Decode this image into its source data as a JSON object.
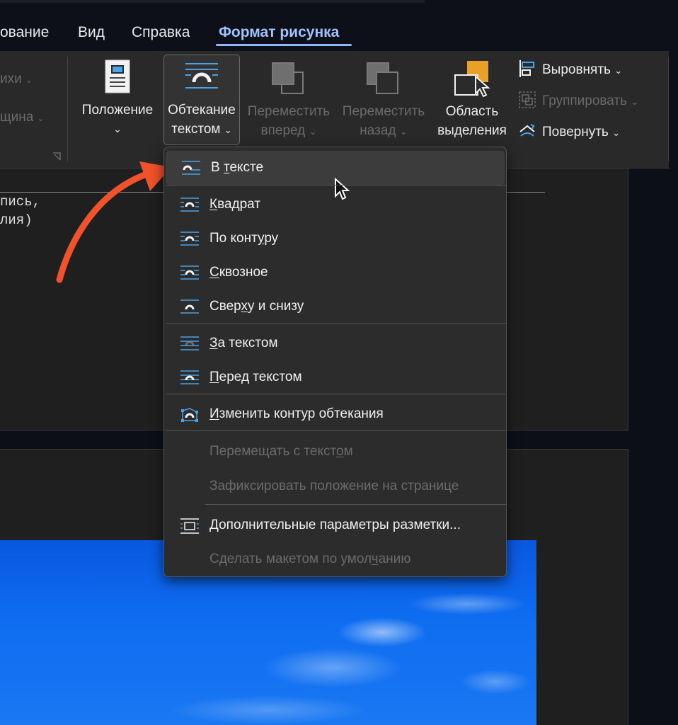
{
  "tabs": [
    {
      "label": "ование"
    },
    {
      "label": "Вид"
    },
    {
      "label": "Справка"
    },
    {
      "label": "Формат рисунка"
    }
  ],
  "ribbon": {
    "left_partial": {
      "item1": "ихи",
      "item2": "щина"
    },
    "position": {
      "line1": "Положение"
    },
    "wrap": {
      "line1": "Обтекание",
      "line2": "текстом"
    },
    "forward": {
      "line1": "Переместить",
      "line2": "вперед"
    },
    "backward": {
      "line1": "Переместить",
      "line2": "назад"
    },
    "selection": {
      "line1": "Область",
      "line2": "выделения"
    },
    "align": {
      "label": "Выровнять"
    },
    "group": {
      "label": "Группировать"
    },
    "rotate": {
      "label": "Повернуть"
    }
  },
  "document": {
    "line1": "пись,",
    "line2": "лия)"
  },
  "menu": {
    "items": [
      {
        "pre": "В ",
        "ul": "т",
        "post": "ексте",
        "icon": "wrap-inline-icon",
        "enabled": true
      },
      {
        "pre": "",
        "ul": "К",
        "post": "вадрат",
        "icon": "wrap-square-icon",
        "enabled": true
      },
      {
        "pre": "По конт",
        "ul": "у",
        "post": "ру",
        "icon": "wrap-tight-icon",
        "enabled": true
      },
      {
        "pre": "",
        "ul": "С",
        "post": "квозное",
        "icon": "wrap-through-icon",
        "enabled": true
      },
      {
        "pre": "Свер",
        "ul": "х",
        "post": "у и снизу",
        "icon": "wrap-top-bottom-icon",
        "enabled": true
      },
      {
        "pre": "",
        "ul": "З",
        "post": "а текстом",
        "icon": "wrap-behind-icon",
        "enabled": true
      },
      {
        "pre": "",
        "ul": "П",
        "post": "еред текстом",
        "icon": "wrap-front-icon",
        "enabled": true
      },
      {
        "pre": "",
        "ul": "И",
        "post": "зменить контур обтекания",
        "icon": "edit-wrap-points-icon",
        "enabled": true
      },
      {
        "pre": "Перемещать с текст",
        "ul": "о",
        "post": "м",
        "icon": "",
        "enabled": false
      },
      {
        "pre": "Зафиксировать положение на странице",
        "ul": "",
        "post": "",
        "icon": "",
        "enabled": false
      },
      {
        "pre": "",
        "ul": "Д",
        "post": "ополнительные параметры разметки...",
        "icon": "layout-options-icon",
        "enabled": true
      },
      {
        "pre": "Сделать макетом по умол",
        "ul": "ч",
        "post": "анию",
        "icon": "",
        "enabled": false
      }
    ]
  },
  "colors": {
    "accent": "#8fb6ff",
    "icon_blue": "#4aa3e8",
    "arrow": "#f0522b",
    "orange": "#e8a028"
  }
}
